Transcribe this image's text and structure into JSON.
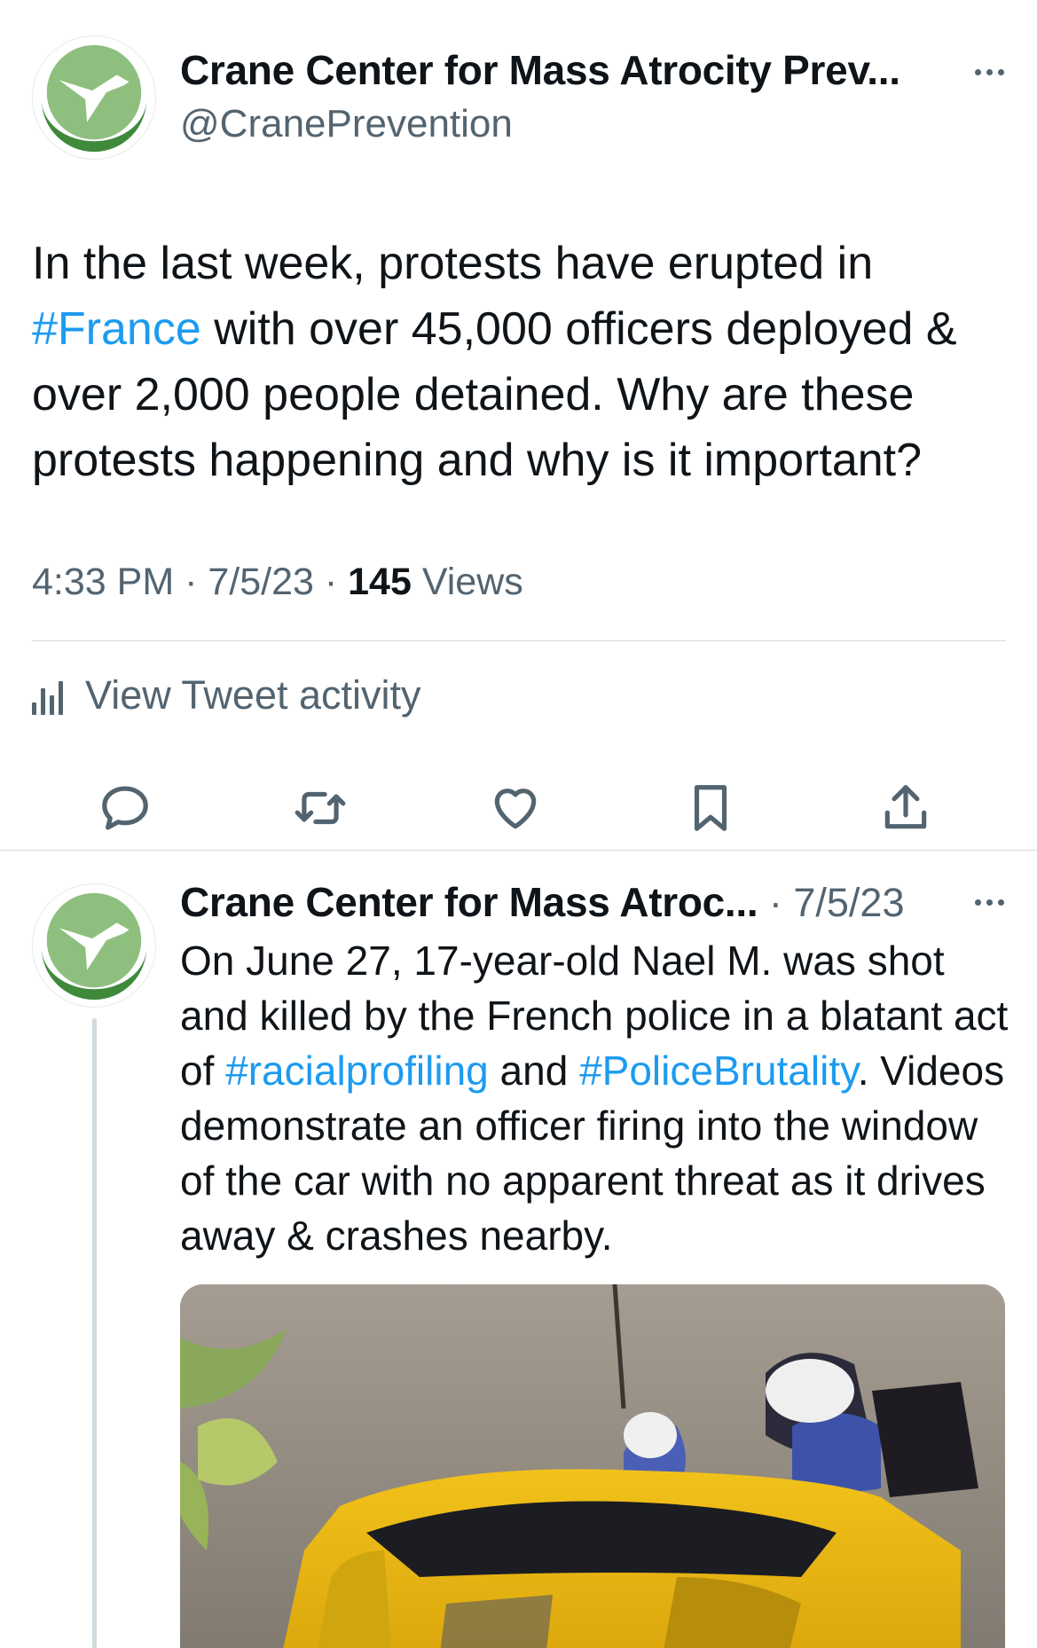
{
  "main_tweet": {
    "author_name": "Crane Center for Mass Atrocity Prev...",
    "handle": "@CranePrevention",
    "text_parts": [
      "In the last week, protests have erupted in ",
      "#France",
      " with over 45,000 officers deployed & over 2,000 people detained. Why are these protests happening and why is it important?"
    ],
    "time": "4:33 PM",
    "separator": " · ",
    "date": "7/5/23",
    "views_count": "145",
    "views_label": " Views",
    "activity_label": "View Tweet activity"
  },
  "actions": [
    "reply-icon",
    "retweet-icon",
    "like-icon",
    "bookmark-icon",
    "share-icon"
  ],
  "reply_tweet": {
    "author_name": "Crane Center for Mass Atroc...",
    "separator": " · ",
    "date": "7/5/23",
    "text_parts": [
      "On June 27, 17-year-old Nael M. was shot and killed by the French police in a blatant act of ",
      "#racialprofiling",
      " and ",
      "#PoliceBrutality",
      ". Videos demonstrate an officer firing into the window of the car with no apparent threat as it drives away & crashes nearby."
    ]
  },
  "colors": {
    "text": "#0f1419",
    "secondary": "#536471",
    "link": "#1d9bf0",
    "divider": "#cfd9de",
    "avatar_green_light": "#8fbf7f",
    "avatar_green_dark": "#3e8a3a"
  }
}
